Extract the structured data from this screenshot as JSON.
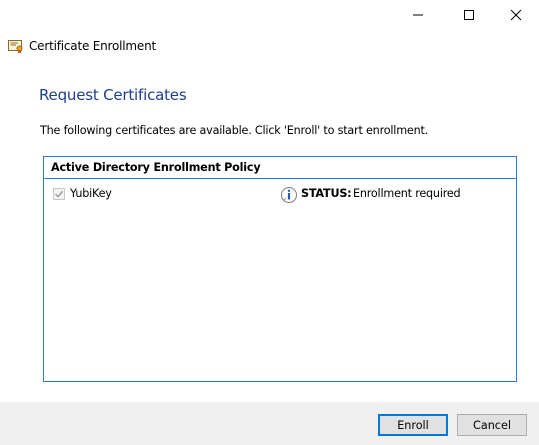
{
  "window": {
    "title": "Certificate Enrollment",
    "controls": {
      "minimize": "minimize-icon",
      "maximize": "maximize-icon",
      "close": "close-icon"
    }
  },
  "page": {
    "heading": "Request Certificates",
    "intro": "The following certificates are available. Click 'Enroll' to start enrollment."
  },
  "policy": {
    "name": "Active Directory Enrollment Policy",
    "certificates": [
      {
        "name": "YubiKey",
        "checked": true,
        "status_label": "STATUS:",
        "status_value": "Enrollment required"
      }
    ]
  },
  "footer": {
    "enroll_label": "Enroll",
    "cancel_label": "Cancel"
  },
  "colors": {
    "heading": "#1e3f8c",
    "panel_border": "#2b7bd6",
    "footer_bg": "#f0f0f0",
    "default_button_border": "#0078d7"
  }
}
